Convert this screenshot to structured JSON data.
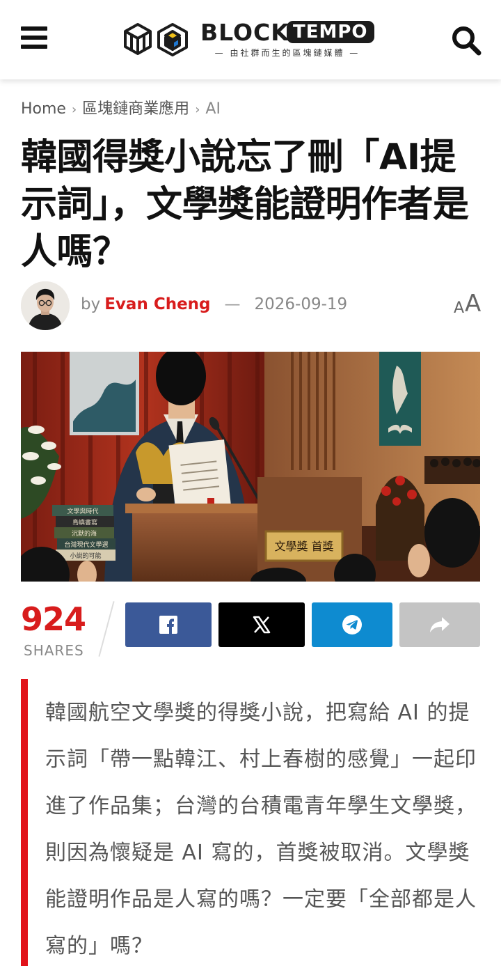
{
  "header": {
    "logo_block": "BLOCK",
    "logo_tempo": "TEMPO",
    "logo_tagline": "— 由社群而生的區塊鏈媒體 —",
    "menu_icon": "hamburger-menu-icon",
    "search_icon": "search-icon"
  },
  "breadcrumb": {
    "items": [
      "Home",
      "區塊鏈商業應用",
      "AI"
    ]
  },
  "article": {
    "title": "韓國得獎小說忘了刪「AI提示詞」，文學獎能證明作者是人嗎？",
    "by_label": "by",
    "author": "Evan Cheng",
    "date_separator": "—",
    "date": "2026-09-19",
    "font_size_small": "A",
    "font_size_large": "A",
    "hero_image": {
      "podium_sign": "文學獎  首獎",
      "books": [
        "文學與時代",
        "島嶼書寫",
        "沉默的海",
        "台灣現代文學選",
        "小說的可能"
      ]
    },
    "lead": "韓國航空文學獎的得獎小說，把寫給 AI 的提示詞「帶一點韓江、村上春樹的感覺」一起印進了作品集；台灣的台積電青年學生文學獎，則因為懷疑是 AI 寫的，首獎被取消。文學獎能證明作品是人寫的嗎？一定要「全部都是人寫的」嗎？"
  },
  "shares": {
    "count": "924",
    "label": "SHARES",
    "buttons": [
      {
        "name": "facebook",
        "icon": "facebook-icon",
        "color": "#3b5998"
      },
      {
        "name": "x",
        "icon": "x-icon",
        "color": "#000000"
      },
      {
        "name": "telegram",
        "icon": "telegram-icon",
        "color": "#0e8bd0"
      },
      {
        "name": "more",
        "icon": "share-arrow-icon",
        "color": "#c4c4c4"
      }
    ]
  },
  "colors": {
    "accent": "#d81c1c",
    "lead_bar": "#e1131a",
    "text": "#111111",
    "muted": "#888888"
  }
}
